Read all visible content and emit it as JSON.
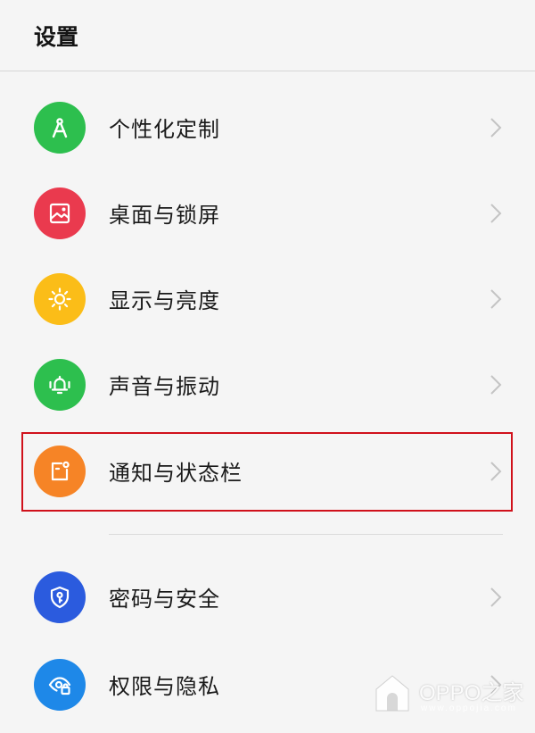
{
  "header": {
    "title": "设置"
  },
  "items": [
    {
      "label": "个性化定制",
      "icon": "compass-icon",
      "color": "#2dbf4e"
    },
    {
      "label": "桌面与锁屏",
      "icon": "image-icon",
      "color": "#ea3a4e"
    },
    {
      "label": "显示与亮度",
      "icon": "sun-icon",
      "color": "#fbbd18"
    },
    {
      "label": "声音与振动",
      "icon": "bell-vibrate-icon",
      "color": "#2dbf4e"
    },
    {
      "label": "通知与状态栏",
      "icon": "notification-icon",
      "color": "#f68426",
      "highlighted": true
    },
    {
      "label": "密码与安全",
      "icon": "shield-key-icon",
      "color": "#2b5bde"
    },
    {
      "label": "权限与隐私",
      "icon": "eye-lock-icon",
      "color": "#1e88e8"
    }
  ],
  "highlight_color": "#d0111b",
  "watermark": {
    "brand": "OPPO之家",
    "url": "www.oppojia.com"
  }
}
